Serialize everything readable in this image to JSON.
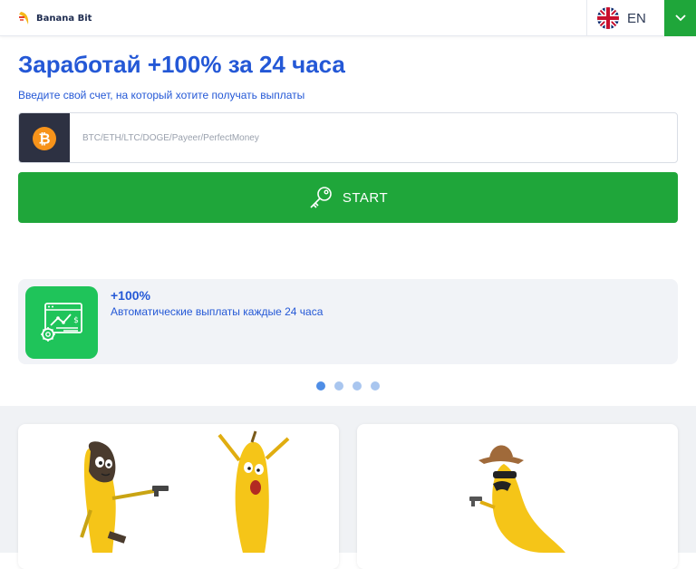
{
  "header": {
    "logo_text": "Banana Bit",
    "language": "EN"
  },
  "hero": {
    "title": "Заработай +100% за 24 часа",
    "subtitle": "Введите свой счет, на который хотите получать выплаты"
  },
  "wallet": {
    "placeholder": "BTC/ETH/LTC/DOGE/Payeer/PerfectMoney",
    "value": ""
  },
  "start_button": {
    "label": "START"
  },
  "slider": {
    "slides": [
      {
        "heading": "+100%",
        "text": "Автоматические выплаты каждые 24 часа"
      }
    ],
    "dot_count": 4,
    "active_index": 0
  },
  "colors": {
    "accent_blue": "#2458d6",
    "green": "#1fa63a",
    "feature_green": "#1fc45a",
    "banana_yellow": "#f5c518"
  },
  "icons": {
    "wallet": "bitcoin-icon",
    "start": "key-icon",
    "language": "uk-flag-icon",
    "toggle": "chevron-down-icon",
    "feature": "browser-chart-gear-icon"
  }
}
